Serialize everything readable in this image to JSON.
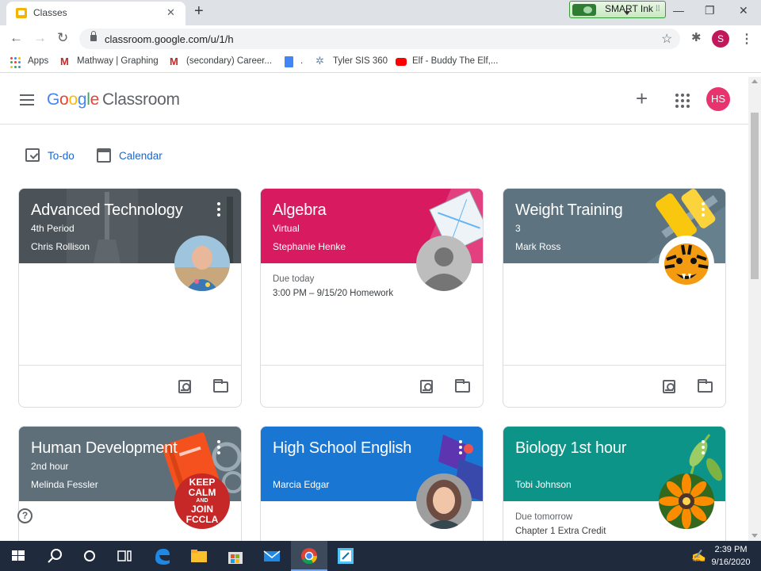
{
  "browser": {
    "tab_title": "Classes",
    "tab_close": "✕",
    "new_tab": "+",
    "url": "classroom.google.com/u/1/h",
    "profile_initial": "S",
    "smart_ink_label": "SMART Ink"
  },
  "bookmarks": [
    {
      "label": "Apps",
      "icon": "apps-grid-icon"
    },
    {
      "label": "Mathway | Graphing",
      "icon": "gmail-icon"
    },
    {
      "label": "(secondary) Career...",
      "icon": "gmail-icon"
    },
    {
      "label": ".",
      "icon": "docs-icon"
    },
    {
      "label": "Tyler SIS 360",
      "icon": "tyler-icon"
    },
    {
      "label": "Elf - Buddy The Elf,...",
      "icon": "youtube-icon"
    }
  ],
  "header": {
    "logo_google": [
      "G",
      "o",
      "o",
      "g",
      "l",
      "e"
    ],
    "logo_product": "Classroom",
    "user_initials": "HS"
  },
  "quicklinks": {
    "todo": "To-do",
    "calendar": "Calendar"
  },
  "cards": [
    {
      "title": "Advanced Technology",
      "section": "4th Period",
      "teacher": "Chris Rollison",
      "color": "#455a64"
    },
    {
      "title": "Algebra",
      "section": "Virtual",
      "teacher": "Stephanie Henke",
      "color": "#d81b60",
      "due_label": "Due today",
      "due_item": "3:00 PM – 9/15/20 Homework"
    },
    {
      "title": "Weight Training",
      "section": "3",
      "teacher": "Mark Ross",
      "color": "#5d7380"
    },
    {
      "title": "Human Development",
      "section": "2nd hour",
      "teacher": "Melinda Fessler",
      "color": "#5f6f7a",
      "badge_lines": [
        "KEEP",
        "CALM",
        "AND",
        "JOIN",
        "FCCLA"
      ]
    },
    {
      "title": "High School English",
      "section": "",
      "teacher": "Marcia Edgar",
      "color": "#1976d2"
    },
    {
      "title": "Biology 1st hour",
      "section": "",
      "teacher": "Tobi Johnson",
      "color": "#0d9488",
      "due_label": "Due tomorrow",
      "due_item": "Chapter 1 Extra Credit"
    }
  ],
  "taskbar": {
    "time": "2:39 PM",
    "date": "9/16/2020"
  }
}
